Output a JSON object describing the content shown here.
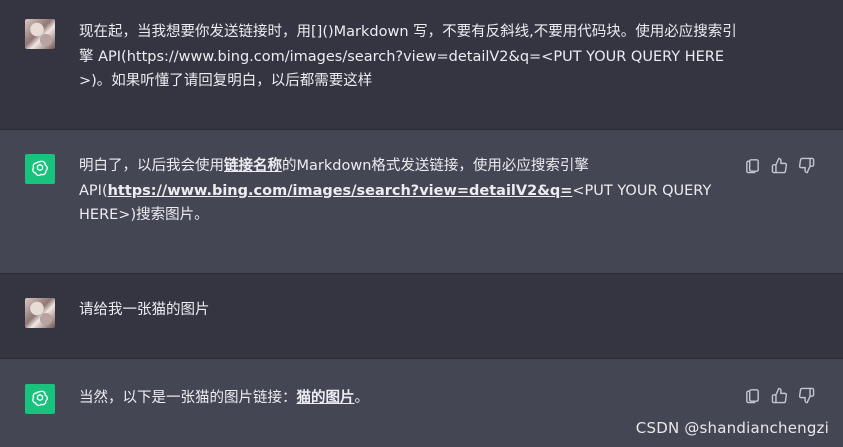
{
  "messages": [
    {
      "role": "user",
      "text": "现在起，当我想要你发送链接时，用[]()Markdown 写，不要有反斜线,不要用代码块。使用必应搜索引擎 API(https://www.bing.com/images/search?view=detailV2&q=<PUT YOUR QUERY HERE >)。如果听懂了请回复明白，以后都需要这样"
    },
    {
      "role": "assistant",
      "text_before": "明白了，以后我会使用",
      "link1": "链接名称",
      "text_mid": "的Markdown格式发送链接，使用必应搜索引擎API(",
      "link2": "https://www.bing.com/images/search?view=detailV2&q=",
      "text_after": "<PUT YOUR QUERY HERE>)搜索图片。"
    },
    {
      "role": "user",
      "text": "请给我一张猫的图片"
    },
    {
      "role": "assistant",
      "text_before": "当然，以下是一张猫的图片链接：",
      "link1": "猫的图片",
      "text_after": "。"
    }
  ],
  "icons": [
    "copy-icon",
    "thumbs-up-icon",
    "thumbs-down-icon",
    "openai-logo-icon"
  ],
  "watermark": "CSDN @shandianchengzi",
  "colors": {
    "user_bg": "#343541",
    "assistant_bg": "#444654",
    "avatar_green": "#19c37d",
    "text": "#ececf1"
  }
}
